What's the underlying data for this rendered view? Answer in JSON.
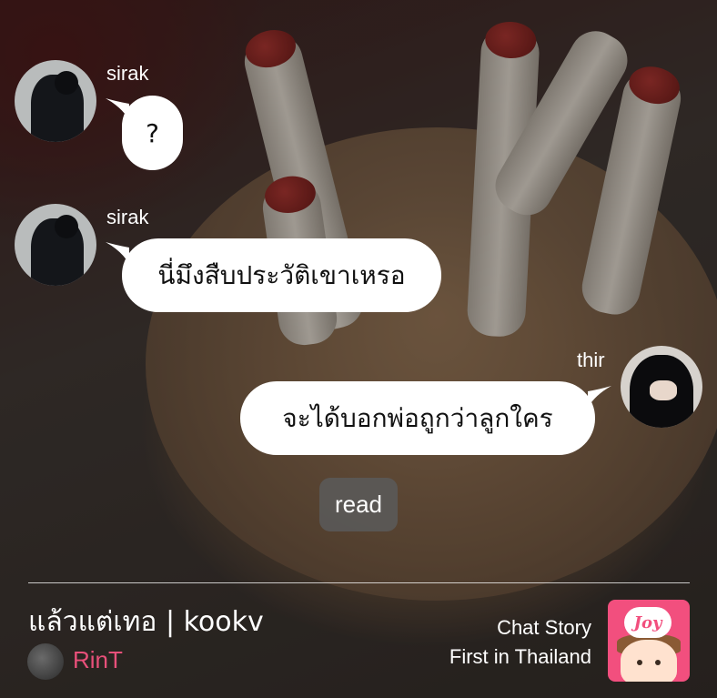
{
  "messages": [
    {
      "sender": "sirak",
      "side": "left",
      "text": "?"
    },
    {
      "sender": "sirak",
      "side": "left",
      "text": "นี่มึงสืบประวัติเขาเหรอ"
    },
    {
      "sender": "thir",
      "side": "right",
      "text": "จะได้บอกพ่อถูกว่าลูกใคร"
    }
  ],
  "read_badge": "read",
  "footer": {
    "story_title": "แล้วแต่เทอ | kookv",
    "author": "RinT",
    "tagline_line1": "Chat Story",
    "tagline_line2": "First in Thailand",
    "logo_text": "Joy"
  },
  "colors": {
    "bubble": "#ffffff",
    "author": "#e8507a",
    "logo_bg": "#f24f7e",
    "read_badge_bg": "#5a5a5a"
  }
}
